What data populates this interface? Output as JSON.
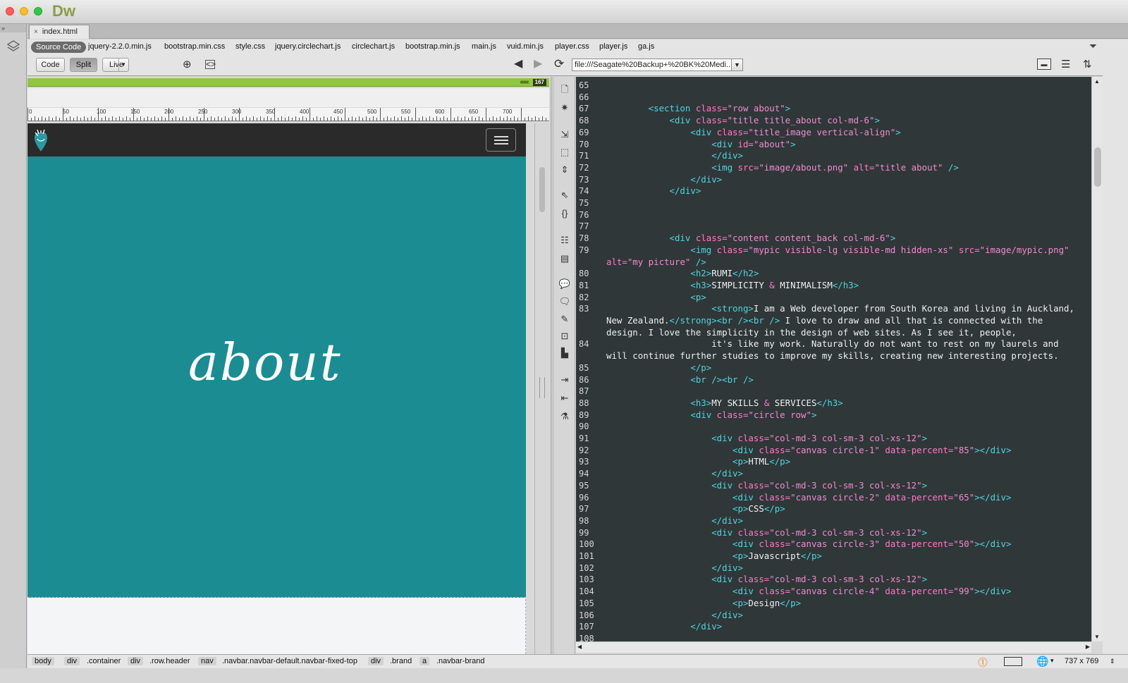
{
  "app": {
    "logo": "Dw"
  },
  "document_tab": {
    "label": "index.html",
    "close": "×"
  },
  "related_files": {
    "source_label": "Source Code",
    "files": [
      "jquery-2.2.0.min.js",
      "bootstrap.min.css",
      "style.css",
      "jquery.circlechart.js",
      "circlechart.js",
      "bootstrap.min.js",
      "main.js",
      "vuid.min.js",
      "player.css",
      "player.js",
      "ga.js"
    ]
  },
  "view_buttons": {
    "code": "Code",
    "split": "Split",
    "live": "Live"
  },
  "address": {
    "value": "file:///Seagate%20Backup+%20BK%20Medi..."
  },
  "design_view": {
    "element_width": "167",
    "ruler_labels": [
      "0",
      "50",
      "100",
      "150",
      "200",
      "250",
      "300",
      "350",
      "400",
      "450",
      "500",
      "550",
      "600",
      "650",
      "700"
    ],
    "about_text": "about"
  },
  "code": {
    "lines": [
      {
        "n": "65",
        "parts": []
      },
      {
        "n": "66",
        "parts": []
      },
      {
        "n": "67",
        "parts": [
          [
            "t",
            "        <section "
          ],
          [
            "a",
            "class="
          ],
          [
            "v",
            "\"row about\""
          ],
          [
            "t",
            ">"
          ]
        ]
      },
      {
        "n": "68",
        "parts": [
          [
            "t",
            "            <div "
          ],
          [
            "a",
            "class="
          ],
          [
            "v",
            "\"title title_about col-md-6\""
          ],
          [
            "t",
            ">"
          ]
        ]
      },
      {
        "n": "69",
        "parts": [
          [
            "t",
            "                <div "
          ],
          [
            "a",
            "class="
          ],
          [
            "v",
            "\"title_image vertical-align\""
          ],
          [
            "t",
            ">"
          ]
        ]
      },
      {
        "n": "70",
        "parts": [
          [
            "t",
            "                    <div "
          ],
          [
            "a",
            "id="
          ],
          [
            "v",
            "\"about\""
          ],
          [
            "t",
            ">"
          ]
        ]
      },
      {
        "n": "71",
        "parts": [
          [
            "t",
            "                    </div>"
          ]
        ]
      },
      {
        "n": "72",
        "parts": [
          [
            "t",
            "                    <img "
          ],
          [
            "a",
            "src="
          ],
          [
            "v",
            "\"image/about.png\" "
          ],
          [
            "a",
            "alt="
          ],
          [
            "v",
            "\"title about\""
          ],
          [
            "t",
            " />"
          ]
        ]
      },
      {
        "n": "73",
        "parts": [
          [
            "t",
            "                </div>"
          ]
        ]
      },
      {
        "n": "74",
        "parts": [
          [
            "t",
            "            </div>"
          ]
        ]
      },
      {
        "n": "75",
        "parts": []
      },
      {
        "n": "76",
        "parts": []
      },
      {
        "n": "77",
        "parts": []
      },
      {
        "n": "78",
        "parts": [
          [
            "t",
            "            <div "
          ],
          [
            "a",
            "class="
          ],
          [
            "v",
            "\"content content_back col-md-6\""
          ],
          [
            "t",
            ">"
          ]
        ]
      },
      {
        "n": "79",
        "parts": [
          [
            "t",
            "                <img "
          ],
          [
            "a",
            "class="
          ],
          [
            "v",
            "\"mypic visible-lg visible-md hidden-xs\" "
          ],
          [
            "a",
            "src="
          ],
          [
            "v",
            "\"image/mypic.png\""
          ]
        ]
      },
      {
        "n": "",
        "parts": [
          [
            "a",
            "alt="
          ],
          [
            "v",
            "\"my picture\""
          ],
          [
            "t",
            " />"
          ]
        ]
      },
      {
        "n": "80",
        "parts": [
          [
            "t",
            "                <h2>"
          ],
          [
            "p",
            "RUMI"
          ],
          [
            "t",
            "</h2>"
          ]
        ]
      },
      {
        "n": "81",
        "parts": [
          [
            "t",
            "                <h3>"
          ],
          [
            "p",
            "SIMPLICITY "
          ],
          [
            "a",
            "&amp;"
          ],
          [
            "p",
            " MINIMALISM"
          ],
          [
            "t",
            "</h3>"
          ]
        ]
      },
      {
        "n": "82",
        "parts": [
          [
            "t",
            "                <p>"
          ]
        ]
      },
      {
        "n": "83",
        "parts": [
          [
            "t",
            "                    <strong>"
          ],
          [
            "p",
            "I am a Web developer from South Korea and living in Auckland,"
          ]
        ]
      },
      {
        "n": "",
        "parts": [
          [
            "p",
            "New Zealand."
          ],
          [
            "t",
            "</strong><br /><br />"
          ],
          [
            "p",
            " I love to draw and all that is connected with the"
          ]
        ]
      },
      {
        "n": "",
        "parts": [
          [
            "p",
            "design. I love the simplicity in the design of web sites. As I see it, people,"
          ]
        ]
      },
      {
        "n": "84",
        "parts": [
          [
            "p",
            "                    it's like my work. Naturally do not want to rest on my laurels and"
          ]
        ]
      },
      {
        "n": "",
        "parts": [
          [
            "p",
            "will continue further studies to improve my skills, creating new interesting projects."
          ]
        ]
      },
      {
        "n": "85",
        "parts": [
          [
            "t",
            "                </p>"
          ]
        ]
      },
      {
        "n": "86",
        "parts": [
          [
            "t",
            "                <br /><br />"
          ]
        ]
      },
      {
        "n": "87",
        "parts": []
      },
      {
        "n": "88",
        "parts": [
          [
            "t",
            "                <h3>"
          ],
          [
            "p",
            "MY SKILLS "
          ],
          [
            "a",
            "&amp;"
          ],
          [
            "p",
            " SERVICES"
          ],
          [
            "t",
            "</h3>"
          ]
        ]
      },
      {
        "n": "89",
        "parts": [
          [
            "t",
            "                <div "
          ],
          [
            "a",
            "class="
          ],
          [
            "v",
            "\"circle row\""
          ],
          [
            "t",
            ">"
          ]
        ]
      },
      {
        "n": "90",
        "parts": []
      },
      {
        "n": "91",
        "parts": [
          [
            "t",
            "                    <div "
          ],
          [
            "a",
            "class="
          ],
          [
            "v",
            "\"col-md-3 col-sm-3 col-xs-12\""
          ],
          [
            "t",
            ">"
          ]
        ]
      },
      {
        "n": "92",
        "parts": [
          [
            "t",
            "                        <div "
          ],
          [
            "a",
            "class="
          ],
          [
            "v",
            "\"canvas circle-1\" "
          ],
          [
            "a",
            "data-percent="
          ],
          [
            "v",
            "\"85\""
          ],
          [
            "t",
            "></div>"
          ]
        ]
      },
      {
        "n": "93",
        "parts": [
          [
            "t",
            "                        <p>"
          ],
          [
            "p",
            "HTML"
          ],
          [
            "t",
            "</p>"
          ]
        ]
      },
      {
        "n": "94",
        "parts": [
          [
            "t",
            "                    </div>"
          ]
        ]
      },
      {
        "n": "95",
        "parts": [
          [
            "t",
            "                    <div "
          ],
          [
            "a",
            "class="
          ],
          [
            "v",
            "\"col-md-3 col-sm-3 col-xs-12\""
          ],
          [
            "t",
            ">"
          ]
        ]
      },
      {
        "n": "96",
        "parts": [
          [
            "t",
            "                        <div "
          ],
          [
            "a",
            "class="
          ],
          [
            "v",
            "\"canvas circle-2\" "
          ],
          [
            "a",
            "data-percent="
          ],
          [
            "v",
            "\"65\""
          ],
          [
            "t",
            "></div>"
          ]
        ]
      },
      {
        "n": "97",
        "parts": [
          [
            "t",
            "                        <p>"
          ],
          [
            "p",
            "CSS"
          ],
          [
            "t",
            "</p>"
          ]
        ]
      },
      {
        "n": "98",
        "parts": [
          [
            "t",
            "                    </div>"
          ]
        ]
      },
      {
        "n": "99",
        "parts": [
          [
            "t",
            "                    <div "
          ],
          [
            "a",
            "class="
          ],
          [
            "v",
            "\"col-md-3 col-sm-3 col-xs-12\""
          ],
          [
            "t",
            ">"
          ]
        ]
      },
      {
        "n": "100",
        "parts": [
          [
            "t",
            "                        <div "
          ],
          [
            "a",
            "class="
          ],
          [
            "v",
            "\"canvas circle-3\" "
          ],
          [
            "a",
            "data-percent="
          ],
          [
            "v",
            "\"50\""
          ],
          [
            "t",
            "></div>"
          ]
        ]
      },
      {
        "n": "101",
        "parts": [
          [
            "t",
            "                        <p>"
          ],
          [
            "p",
            "Javascript"
          ],
          [
            "t",
            "</p>"
          ]
        ]
      },
      {
        "n": "102",
        "parts": [
          [
            "t",
            "                    </div>"
          ]
        ]
      },
      {
        "n": "103",
        "parts": [
          [
            "t",
            "                    <div "
          ],
          [
            "a",
            "class="
          ],
          [
            "v",
            "\"col-md-3 col-sm-3 col-xs-12\""
          ],
          [
            "t",
            ">"
          ]
        ]
      },
      {
        "n": "104",
        "parts": [
          [
            "t",
            "                        <div "
          ],
          [
            "a",
            "class="
          ],
          [
            "v",
            "\"canvas circle-4\" "
          ],
          [
            "a",
            "data-percent="
          ],
          [
            "v",
            "\"99\""
          ],
          [
            "t",
            "></div>"
          ]
        ]
      },
      {
        "n": "105",
        "parts": [
          [
            "t",
            "                        <p>"
          ],
          [
            "p",
            "Design"
          ],
          [
            "t",
            "</p>"
          ]
        ]
      },
      {
        "n": "106",
        "parts": [
          [
            "t",
            "                    </div>"
          ]
        ]
      },
      {
        "n": "107",
        "parts": [
          [
            "t",
            "                </div>"
          ]
        ]
      },
      {
        "n": "108",
        "parts": []
      }
    ]
  },
  "status_bar": {
    "tags": [
      {
        "tag": "body",
        "cls": ""
      },
      {
        "tag": "div",
        "cls": ".container"
      },
      {
        "tag": "div",
        "cls": ".row.header"
      },
      {
        "tag": "nav",
        "cls": ".navbar.navbar-default.navbar-fixed-top"
      },
      {
        "tag": "div",
        "cls": ".brand"
      },
      {
        "tag": "a",
        "cls": ".navbar-brand"
      }
    ],
    "window_size": "737 x 769"
  },
  "colors": {
    "accent": "#8a9d46",
    "teal": "#1b8d92",
    "code_bg": "#2f3738",
    "tag": "#4fd6e0",
    "attr": "#ff79c6"
  }
}
